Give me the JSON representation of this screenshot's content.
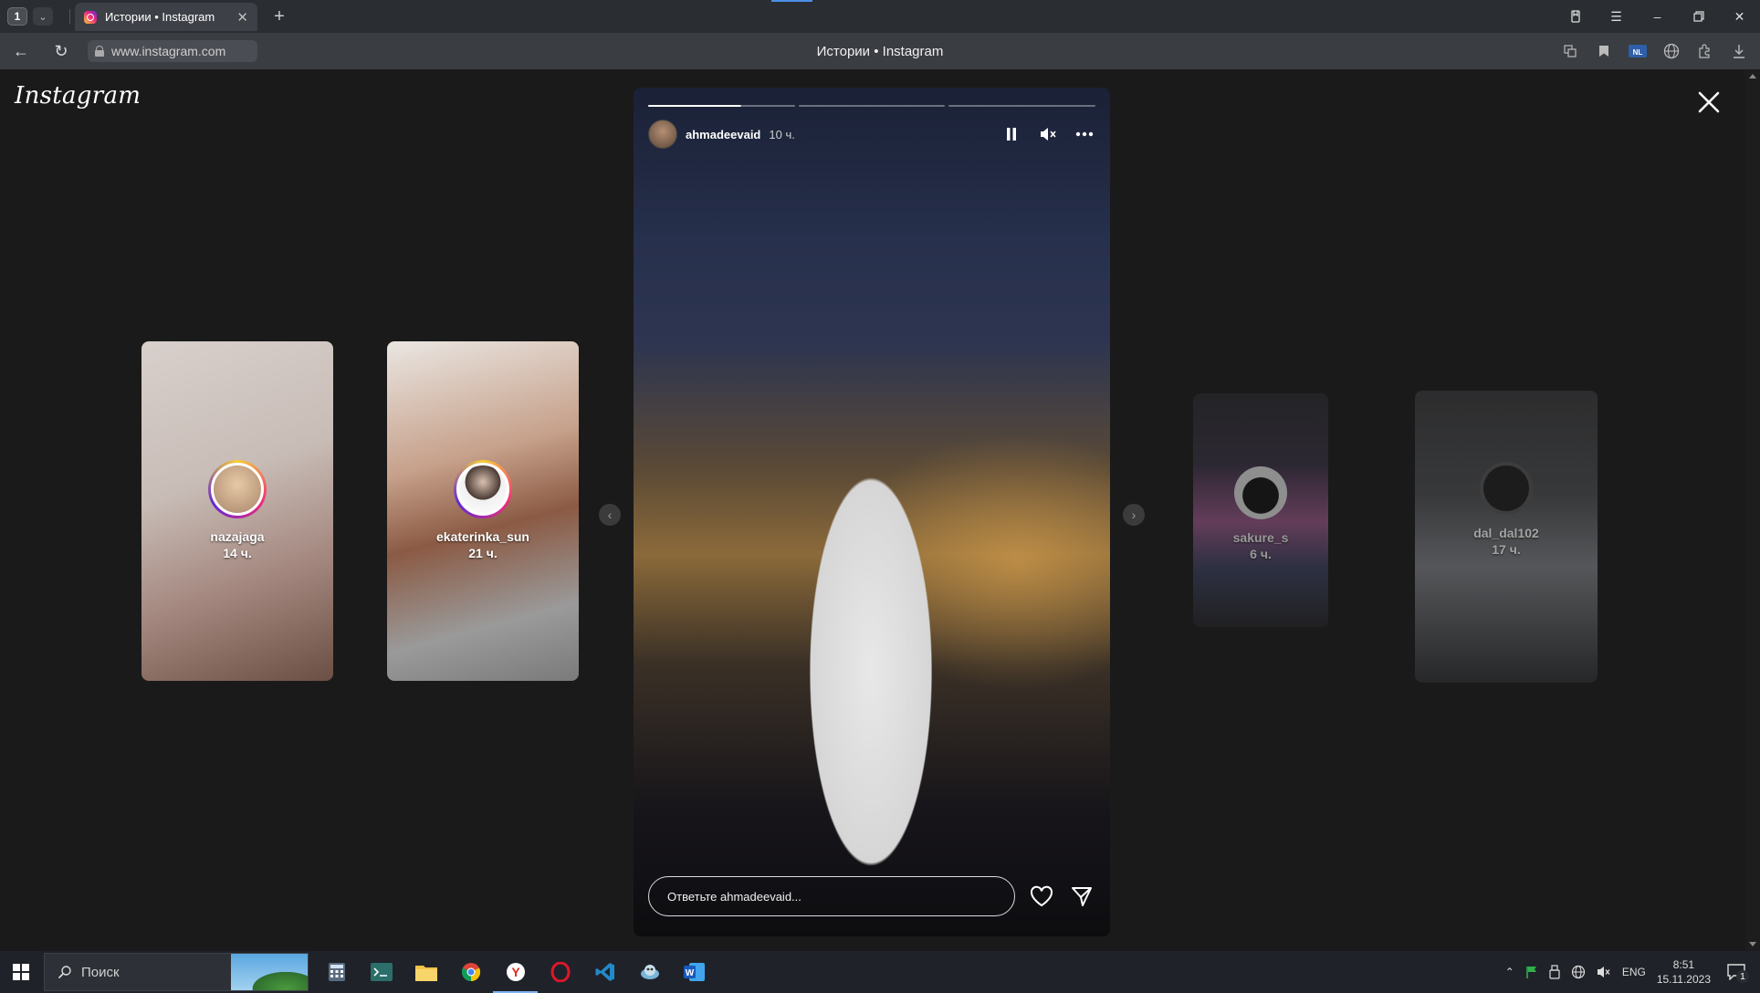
{
  "browser": {
    "tab_count": "1",
    "tab_title": "Истории • Instagram",
    "url": "www.instagram.com",
    "page_title": "Истории • Instagram"
  },
  "page": {
    "logo_text": "Instagram",
    "previews": [
      {
        "username": "nazajaga",
        "time": "14 ч."
      },
      {
        "username": "ekaterinka_sun",
        "time": "21 ч."
      },
      {
        "username": "sakure_s",
        "time": "6 ч."
      },
      {
        "username": "dal_dal102",
        "time": "17 ч."
      }
    ],
    "story": {
      "username": "ahmadeevaid",
      "time": "10 ч.",
      "segments": 3,
      "current_segment_progress": 0.63,
      "reply_placeholder": "Ответьте ahmadeevaid..."
    }
  },
  "taskbar": {
    "search_placeholder": "Поиск",
    "lang": "ENG",
    "time": "8:51",
    "date": "15.11.2023",
    "notif_count": "1"
  },
  "colors": {
    "ig_gradient": [
      "#f9ce34",
      "#ee2a7b",
      "#6228d7"
    ],
    "chrome_bg": "#2a2d31",
    "page_bg": "#1a1a1a"
  }
}
